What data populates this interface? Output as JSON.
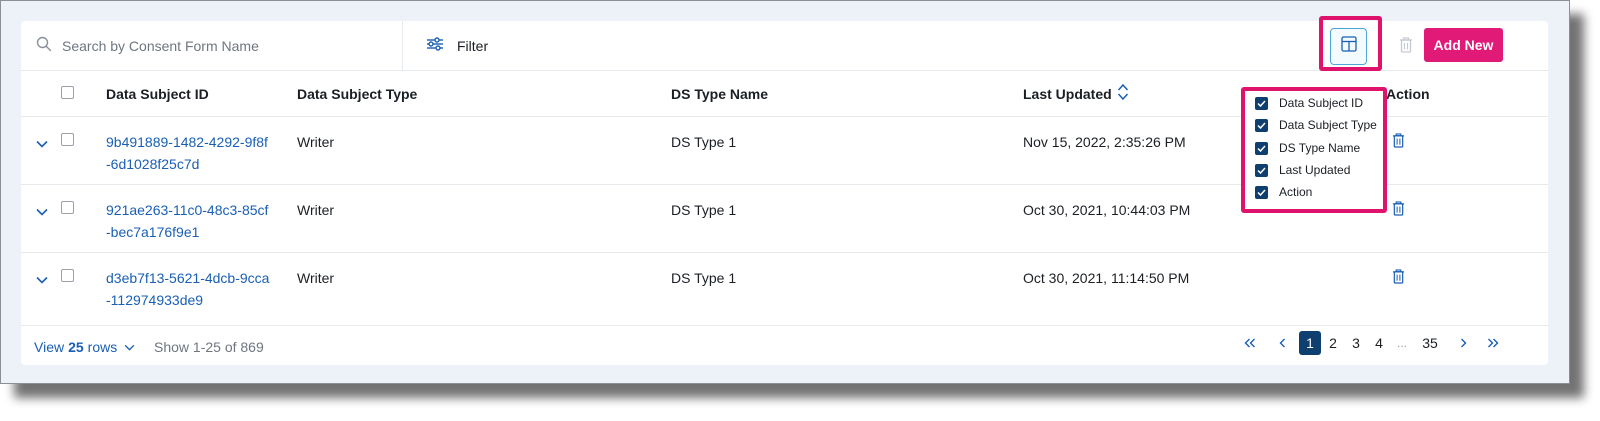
{
  "search": {
    "placeholder": "Search by Consent Form Name"
  },
  "toolbar": {
    "filter_label": "Filter",
    "add_new_label": "Add New"
  },
  "table": {
    "columns": {
      "data_subject_id": "Data Subject ID",
      "data_subject_type": "Data Subject Type",
      "ds_type_name": "DS Type Name",
      "last_updated": "Last Updated",
      "action": "Action"
    },
    "rows": [
      {
        "id": "9b491889-1482-4292-9f8f-6d1028f25c7d",
        "type": "Writer",
        "ds_type_name": "DS Type 1",
        "last_updated": "Nov 15, 2022, 2:35:26 PM"
      },
      {
        "id": "921ae263-11c0-48c3-85cf-bec7a176f9e1",
        "type": "Writer",
        "ds_type_name": "DS Type 1",
        "last_updated": "Oct 30, 2021, 10:44:03 PM"
      },
      {
        "id": "d3eb7f13-5621-4dcb-9cca-112974933de9",
        "type": "Writer",
        "ds_type_name": "DS Type 1",
        "last_updated": "Oct 30, 2021, 11:14:50 PM"
      }
    ]
  },
  "column_menu": {
    "items": [
      {
        "label": "Data Subject ID",
        "checked": true
      },
      {
        "label": "Data Subject Type",
        "checked": true
      },
      {
        "label": "DS Type Name",
        "checked": true
      },
      {
        "label": "Last Updated",
        "checked": true
      },
      {
        "label": "Action",
        "checked": true
      }
    ]
  },
  "footer": {
    "view_prefix": "View",
    "rows_per_page": "25",
    "view_suffix": "rows",
    "show_count": "Show 1-25 of 869"
  },
  "pagination": {
    "pages": [
      "1",
      "2",
      "3",
      "4"
    ],
    "current": "1",
    "ellipsis": "...",
    "last_page": "35"
  },
  "colors": {
    "accent_pink": "#e11a77",
    "link_blue": "#1a5fb4",
    "navy": "#0e3f6e",
    "highlight": "#e0136c"
  },
  "icons": {
    "search": "search-icon",
    "filter": "sliders-icon",
    "columns": "columns-icon",
    "delete": "trash-icon",
    "expand": "chevron-down-icon",
    "sort": "sort-icon"
  }
}
